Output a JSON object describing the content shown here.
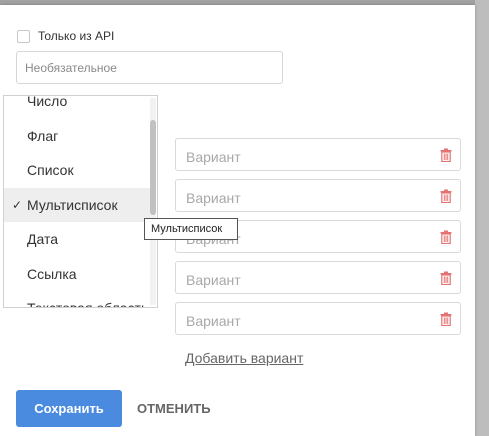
{
  "form": {
    "api_only_label": "Только из API",
    "api_only_checked": false,
    "description_placeholder": "Необязательное"
  },
  "type_dropdown": {
    "items": [
      {
        "label": "Число",
        "selected": false
      },
      {
        "label": "Флаг",
        "selected": false
      },
      {
        "label": "Список",
        "selected": false
      },
      {
        "label": "Мультисписок",
        "selected": true
      },
      {
        "label": "Дата",
        "selected": false
      },
      {
        "label": "Ссылка",
        "selected": false
      },
      {
        "label": "Текстовая область",
        "selected": false
      }
    ],
    "check_glyph": "✓"
  },
  "tooltip": {
    "text": "Мультисписок"
  },
  "variants": {
    "placeholder": "Вариант",
    "items": [
      {
        "value": ""
      },
      {
        "value": ""
      },
      {
        "value": ""
      },
      {
        "value": ""
      },
      {
        "value": ""
      }
    ],
    "delete_icon": "trash-icon",
    "delete_icon_color": "#e57373",
    "add_label": "Добавить вариант"
  },
  "actions": {
    "save_label": "Сохранить",
    "cancel_label": "ОТМЕНИТЬ",
    "save_color": "#4a8be0"
  }
}
